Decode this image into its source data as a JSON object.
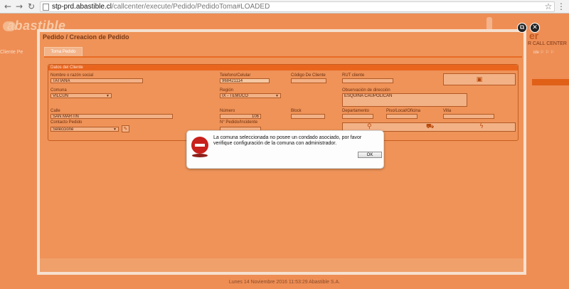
{
  "browser": {
    "url_host": "stp-prd.abastible.cl",
    "url_path": "/callcenter/execute/Pedido/PedidoToma#LOADED",
    "back_icon": "arrow-left-icon",
    "forward_icon": "arrow-right-icon",
    "reload_icon": "reload-icon",
    "star_icon": "star-icon",
    "menu_icon": "kebab-menu-icon"
  },
  "background": {
    "logo": "abastible",
    "menu_text": "Cliente  Pe",
    "header_title": "er",
    "header_subtitle": "R CALL CENTER",
    "header_links": "ide  ⚐  ⚐  ⚐",
    "footer": "Lunes 14 Noviembre 2016 11:53:29 Abastible S.A."
  },
  "window": {
    "title": "Pedido / Creacion de Pedido",
    "tab_label": "Toma Pedido",
    "section_title": "Datos del Cliente",
    "fields": {
      "nombre_label": "Nombre o razón social",
      "nombre_value": "TATIANA",
      "telefono_label": "Telefono/Celular",
      "telefono_value": "968421114",
      "codigo_label": "Código De Cliente",
      "codigo_value": "",
      "rut_label": "RUT cliente",
      "rut_value": "",
      "comuna_label": "Comuna",
      "comuna_value": "VILCUN",
      "region_label": "Región",
      "region_value": "IX - TEMUCO",
      "observacion_label": "Observación de dirección",
      "observacion_value": "ESQUINA CAUPOLICAN",
      "calle_label": "Calle",
      "calle_value": "SAN MARTIN",
      "numero_label": "Número",
      "numero_value": "106",
      "block_label": "Block",
      "block_value": "",
      "departamento_label": "Departamento",
      "departamento_value": "",
      "piso_label": "Piso/Local/Oficina",
      "piso_value": "",
      "villa_label": "Villa",
      "villa_value": "",
      "contacto_label": "Contacto Pedido",
      "contacto_value": "Seleccione",
      "pedido_label": "N° Pedido/Incidente",
      "pedido_value": ""
    }
  },
  "dialog": {
    "message": "La comuna seleccionada no posee un condado asociado, por favor verifique configuración de la comuna con administrador.",
    "ok_label": "OK",
    "icon": "stop-icon"
  },
  "colors": {
    "overlay": "#ee8e55",
    "dialog_bg": "#fdfdfd",
    "stop_red": "#c8201c"
  }
}
